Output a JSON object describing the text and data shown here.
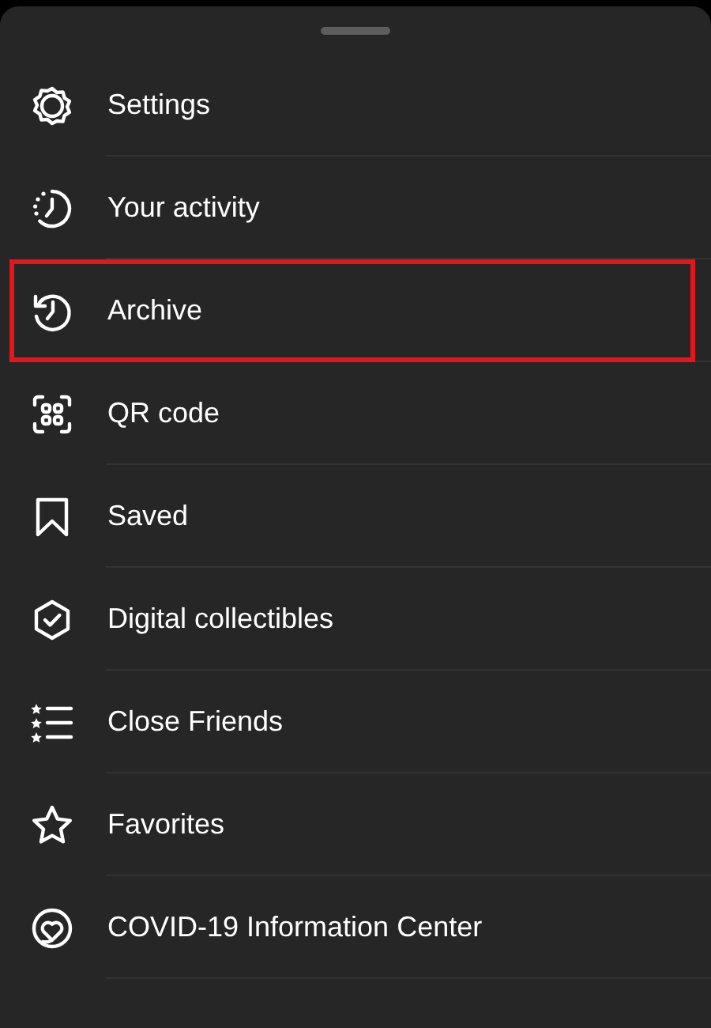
{
  "menu_items": [
    {
      "label": "Settings",
      "highlighted": false
    },
    {
      "label": "Your activity",
      "highlighted": false
    },
    {
      "label": "Archive",
      "highlighted": true
    },
    {
      "label": "QR code",
      "highlighted": false
    },
    {
      "label": "Saved",
      "highlighted": false
    },
    {
      "label": "Digital collectibles",
      "highlighted": false
    },
    {
      "label": "Close Friends",
      "highlighted": false
    },
    {
      "label": "Favorites",
      "highlighted": false
    },
    {
      "label": "COVID-19 Information Center",
      "highlighted": false
    }
  ]
}
